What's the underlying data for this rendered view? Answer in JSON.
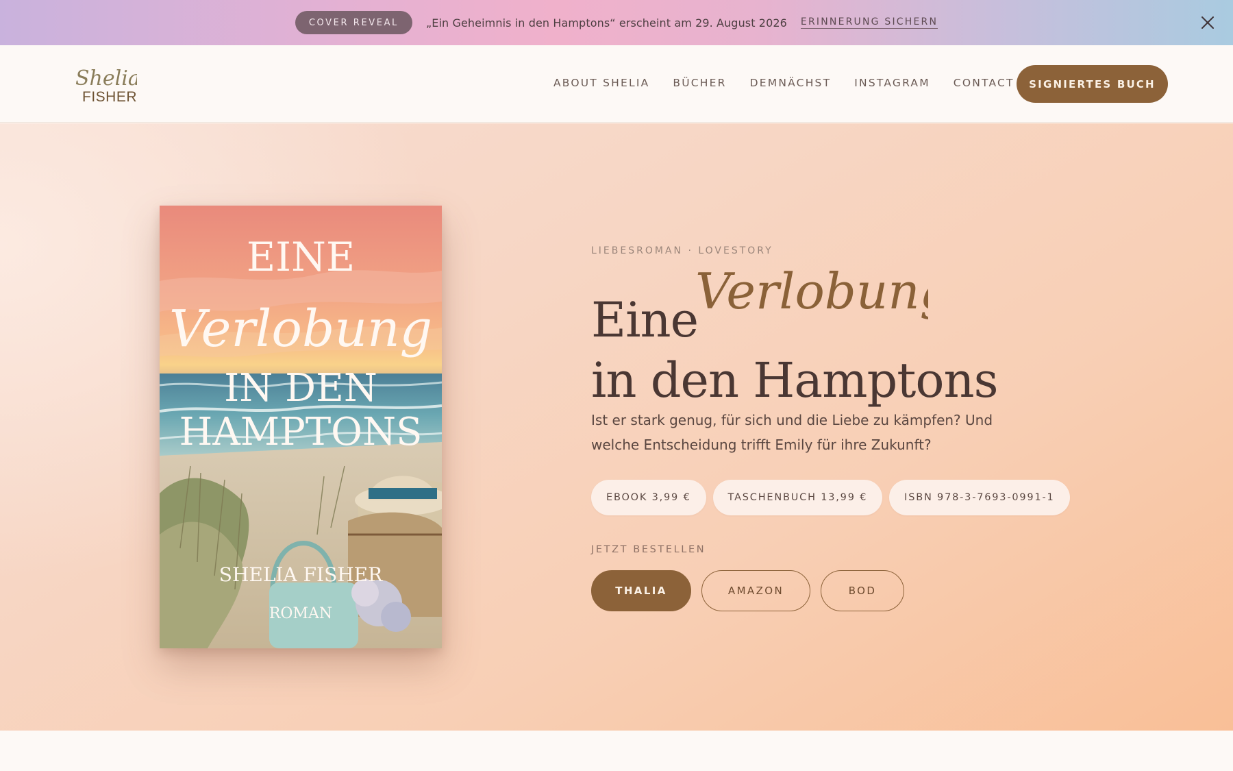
{
  "announcement": {
    "badge": "COVER REVEAL",
    "text": "„Ein Geheimnis in den Hamptons“ erscheint am 29. August 2026",
    "link": "ERINNERUNG SICHERN",
    "close_icon": "close-icon"
  },
  "header": {
    "logo": {
      "line1": "Shelia",
      "line2": "FISHER"
    },
    "nav": [
      "ABOUT SHELIA",
      "BÜCHER",
      "DEMNÄCHST",
      "INSTAGRAM",
      "CONTACT"
    ],
    "cta": "SIGNIERTES BUCH"
  },
  "hero": {
    "book_cover": {
      "top": "EINE",
      "script": "Verlobung",
      "mid1": "IN DEN",
      "mid2": "HAMPTONS",
      "author": "SHELIA FISHER",
      "subtitle": "ROMAN"
    },
    "genre": "LIEBESROMAN · LOVESTORY",
    "title_part1": "Eine",
    "title_script": "Verlobung",
    "title_line2": "in den Hamptons",
    "lead": "Ist er stark genug, für sich und die Liebe zu kämpfen? Und welche Entscheidung trifft Emily für ihre Zukunft?",
    "chips": [
      "EBOOK 3,99 €",
      "TASCHENBUCH 13,99 €",
      "ISBN 978-3-7693-0991-1"
    ],
    "order_label": "JETZT BESTELLEN",
    "shops": [
      "THALIA",
      "AMAZON",
      "BOD"
    ]
  },
  "colors": {
    "brand_brown": "#8c6239",
    "badge": "#7d6470",
    "text_dark": "#4a3733"
  }
}
